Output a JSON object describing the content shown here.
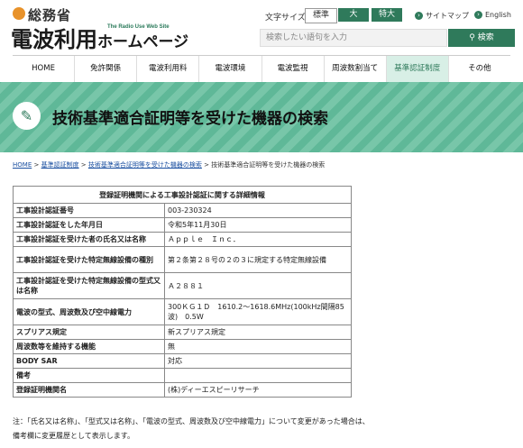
{
  "header": {
    "org": "総務省",
    "site_name": "電波利用",
    "site_name_kana": "ホームページ",
    "tagline": "The Radio Use Web Site",
    "font_size_label": "文字サイズ：",
    "font_sizes": [
      "標準",
      "大",
      "特大"
    ],
    "sitemap": "サイトマップ",
    "english": "English",
    "search_placeholder": "検索したい語句を入力",
    "search_button": "検索"
  },
  "nav": [
    "HOME",
    "免許関係",
    "電波利用料",
    "電波環境",
    "電波監視",
    "周波数割当て",
    "基準認証制度",
    "その他"
  ],
  "banner": {
    "title": "技術基準適合証明等を受けた機器の検索"
  },
  "breadcrumb": {
    "items": [
      "HOME",
      "基準認証制度",
      "技術基準適合証明等を受けた機器の検索",
      "技術基準適合証明等を受けた機器の検索"
    ],
    "sep": " > "
  },
  "table": {
    "title": "登録証明機関による工事設計認証に関する詳細情報",
    "rows": [
      {
        "key": "工事設計認証番号",
        "value": "003-230324"
      },
      {
        "key": "工事設計認証をした年月日",
        "value": "令和5年11月30日"
      },
      {
        "key": "工事設計認証を受けた者の氏名又は名称",
        "value": "Ａｐｐｌｅ　Ｉｎｃ．"
      },
      {
        "key": "工事設計認証を受けた特定無線設備の種別",
        "value": "第２条第２８号の２の３に規定する特定無線設備"
      },
      {
        "key": "工事設計認証を受けた特定無線設備の型式又は名称",
        "value": "Ａ２８８１"
      },
      {
        "key": "電波の型式、周波数及び空中線電力",
        "value": "300ＫＧ１Ｄ　1610.2〜1618.6MHz(100kHz間隔85波)　0.5W"
      },
      {
        "key": "スプリアス規定",
        "value": "新スプリアス規定"
      },
      {
        "key": "周波数等を維持する機能",
        "value": "無"
      },
      {
        "key": "BODY SAR",
        "value": "対応"
      },
      {
        "key": "備考",
        "value": ""
      },
      {
        "key": "登録証明機関名",
        "value": "(株)ディーエスピーリサーチ"
      }
    ]
  },
  "note": "注：「氏名又は名称」、「型式又は名称」、「電波の型式、周波数及び空中線電力」について変更があった場合は、備考欄に変更履歴として表示します。"
}
